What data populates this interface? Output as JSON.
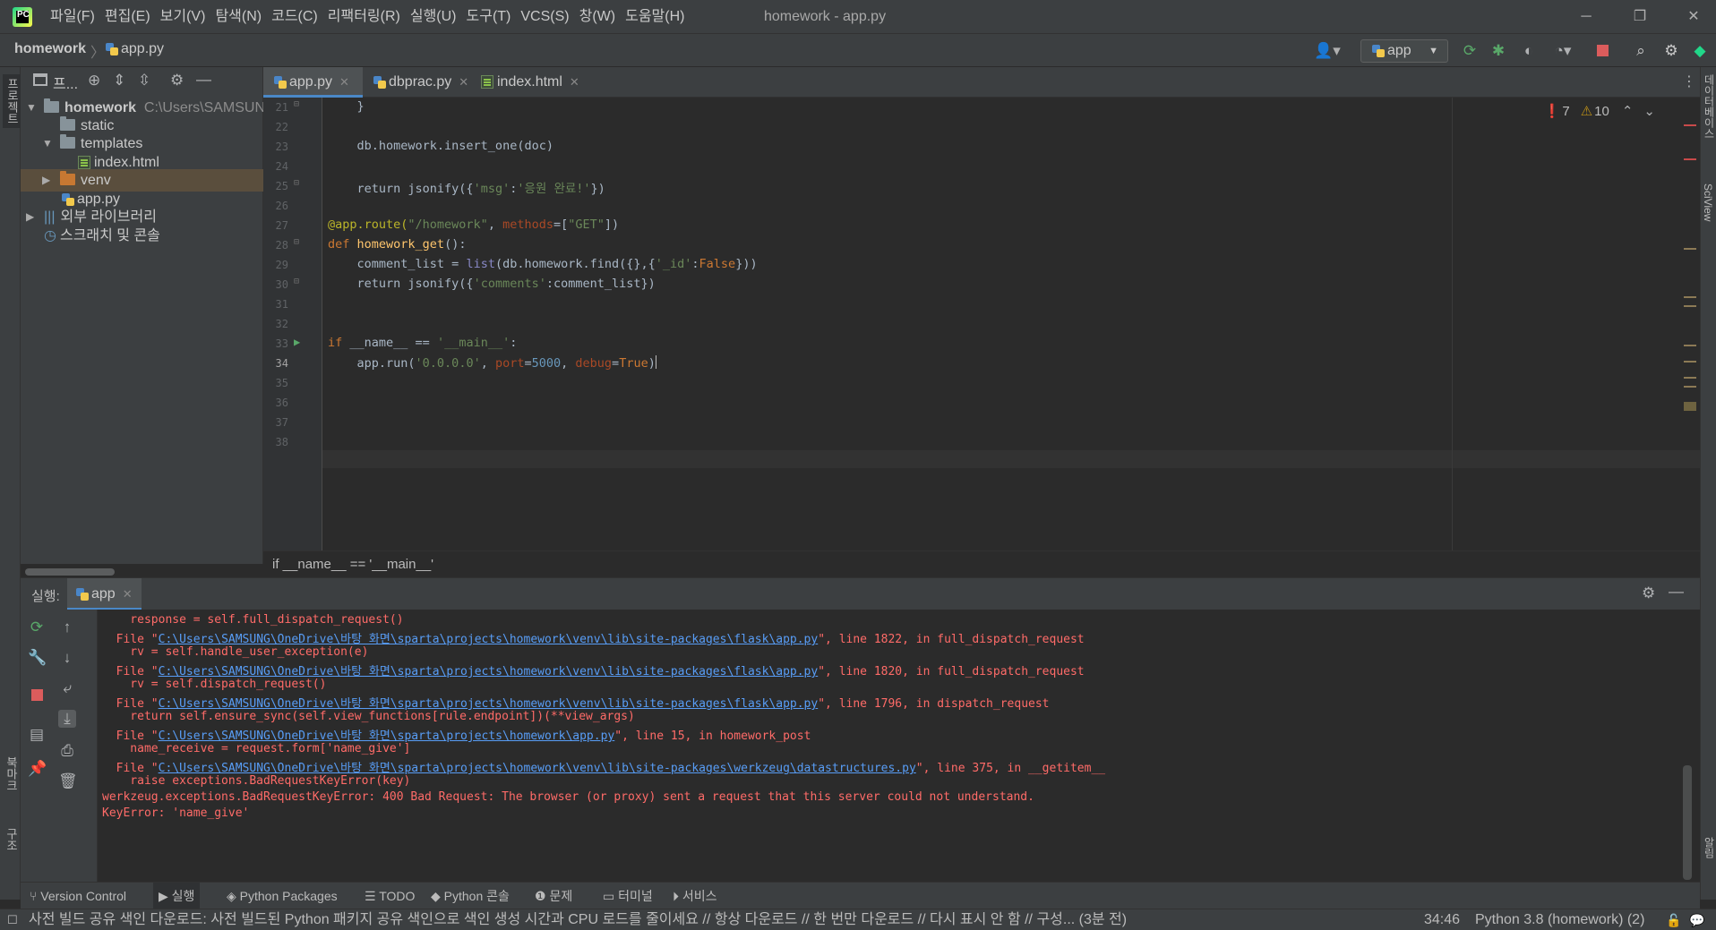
{
  "window": {
    "title": "homework - app.py",
    "menu": [
      "파일(F)",
      "편집(E)",
      "보기(V)",
      "탐색(N)",
      "코드(C)",
      "리팩터링(R)",
      "실행(U)",
      "도구(T)",
      "VCS(S)",
      "창(W)",
      "도움말(H)"
    ],
    "controls": {
      "minimize": "─",
      "restore": "❐",
      "close": "✕"
    }
  },
  "navbar": {
    "project": "homework",
    "file": "app.py",
    "run_config": "app"
  },
  "left_strip": {
    "project_label": "프로젝트",
    "bookmark_label": "북마크",
    "structure_label": "구조"
  },
  "right_strip": {
    "database_label": "데이터베이스",
    "sciview_label": "SciView",
    "notifications_label": "알림"
  },
  "project_panel": {
    "title": "프...",
    "tree": [
      {
        "label": "homework",
        "path": "C:\\Users\\SAMSUNG\\OneDrive\\바탕 화면\\sparta\\projects\\homework"
      },
      {
        "label": "static"
      },
      {
        "label": "templates"
      },
      {
        "label": "index.html"
      },
      {
        "label": "venv"
      },
      {
        "label": "app.py"
      },
      {
        "label": "외부 라이브러리"
      },
      {
        "label": "스크래치 및 콘솔"
      }
    ]
  },
  "tabs": [
    {
      "label": "app.py",
      "active": true
    },
    {
      "label": "dbprac.py",
      "active": false
    },
    {
      "label": "index.html",
      "active": false
    }
  ],
  "editor": {
    "line_numbers": [
      "21",
      "22",
      "23",
      "24",
      "25",
      "26",
      "27",
      "28",
      "29",
      "30",
      "31",
      "32",
      "33",
      "34",
      "35",
      "36",
      "37",
      "38"
    ],
    "current_line": "34",
    "inspections": {
      "errors": "7",
      "warnings": "10"
    },
    "breadcrumb": "if __name__ == '__main__'",
    "code": {
      "l21": "    }",
      "l23": "    db.homework.insert_one(doc)",
      "l25_a": "    return jsonify({",
      "l25_b": "'msg'",
      "l25_c": ":",
      "l25_d": "'응원 완료!'",
      "l25_e": "})",
      "l27_a": "@app.route(",
      "l27_b": "\"/homework\"",
      "l27_c": ", ",
      "l27_d": "methods",
      "l27_e": "=[",
      "l27_f": "\"GET\"",
      "l27_g": "])",
      "l28_a": "def ",
      "l28_b": "homework_get",
      "l28_c": "():",
      "l29_a": "    comment_list = ",
      "l29_b": "list",
      "l29_c": "(db.homework.find({},{",
      "l29_d": "'_id'",
      "l29_e": ":",
      "l29_f": "False",
      "l29_g": "}))",
      "l30_a": "    return jsonify({",
      "l30_b": "'comments'",
      "l30_c": ":comment_list})",
      "l33_a": "if ",
      "l33_b": "__name__ == ",
      "l33_c": "'__main__'",
      "l33_d": ":",
      "l34_a": "    app.run(",
      "l34_b": "'0.0.0.0'",
      "l34_c": ", ",
      "l34_d": "port",
      "l34_e": "=",
      "l34_f": "5000",
      "l34_g": ", ",
      "l34_h": "debug",
      "l34_i": "=",
      "l34_j": "True",
      "l34_k": ")"
    }
  },
  "run_panel": {
    "label": "실행:",
    "tab": "app",
    "console": [
      {
        "pre": "    response = self.full_dispatch_request()",
        "link": "",
        "post": ""
      },
      {
        "pre": "  File \"",
        "link": "C:\\Users\\SAMSUNG\\OneDrive\\바탕 화면\\sparta\\projects\\homework\\venv\\lib\\site-packages\\flask\\app.py",
        "post": "\", line 1822, in full_dispatch_request"
      },
      {
        "pre": "    rv = self.handle_user_exception(e)",
        "link": "",
        "post": ""
      },
      {
        "pre": "  File \"",
        "link": "C:\\Users\\SAMSUNG\\OneDrive\\바탕 화면\\sparta\\projects\\homework\\venv\\lib\\site-packages\\flask\\app.py",
        "post": "\", line 1820, in full_dispatch_request"
      },
      {
        "pre": "    rv = self.dispatch_request()",
        "link": "",
        "post": ""
      },
      {
        "pre": "  File \"",
        "link": "C:\\Users\\SAMSUNG\\OneDrive\\바탕 화면\\sparta\\projects\\homework\\venv\\lib\\site-packages\\flask\\app.py",
        "post": "\", line 1796, in dispatch_request"
      },
      {
        "pre": "    return self.ensure_sync(self.view_functions[rule.endpoint])(**view_args)",
        "link": "",
        "post": ""
      },
      {
        "pre": "  File \"",
        "link": "C:\\Users\\SAMSUNG\\OneDrive\\바탕 화면\\sparta\\projects\\homework\\app.py",
        "post": "\", line 15, in homework_post"
      },
      {
        "pre": "    name_receive = request.form['name_give']",
        "link": "",
        "post": ""
      },
      {
        "pre": "  File \"",
        "link": "C:\\Users\\SAMSUNG\\OneDrive\\바탕 화면\\sparta\\projects\\homework\\venv\\lib\\site-packages\\werkzeug\\datastructures.py",
        "post": "\", line 375, in __getitem__"
      },
      {
        "pre": "    raise exceptions.BadRequestKeyError(key)",
        "link": "",
        "post": ""
      },
      {
        "pre": "werkzeug.exceptions.BadRequestKeyError: 400 Bad Request: The browser (or proxy) sent a request that this server could not understand.",
        "link": "",
        "post": ""
      },
      {
        "pre": "KeyError: 'name_give'",
        "link": "",
        "post": ""
      }
    ]
  },
  "bottom_tools": [
    "Version Control",
    "실행",
    "Python Packages",
    "TODO",
    "Python 콘솔",
    "문제",
    "터미널",
    "서비스"
  ],
  "status": {
    "message": "사전 빌드 공유 색인 다운로드: 사전 빌드된 Python 패키지 공유 색인으로 색인 생성 시간과 CPU 로드를 줄이세요 // 항상 다운로드 // 한 번만 다운로드 // 다시 표시 안 함 // 구성... (3분 전)",
    "position": "34:46",
    "interpreter": "Python 3.8 (homework) (2)"
  },
  "colors": {
    "accent": "#4a88c7",
    "error_text": "#ff6b68",
    "link": "#589df6",
    "keyword": "#cc7832",
    "string": "#6a8759"
  }
}
